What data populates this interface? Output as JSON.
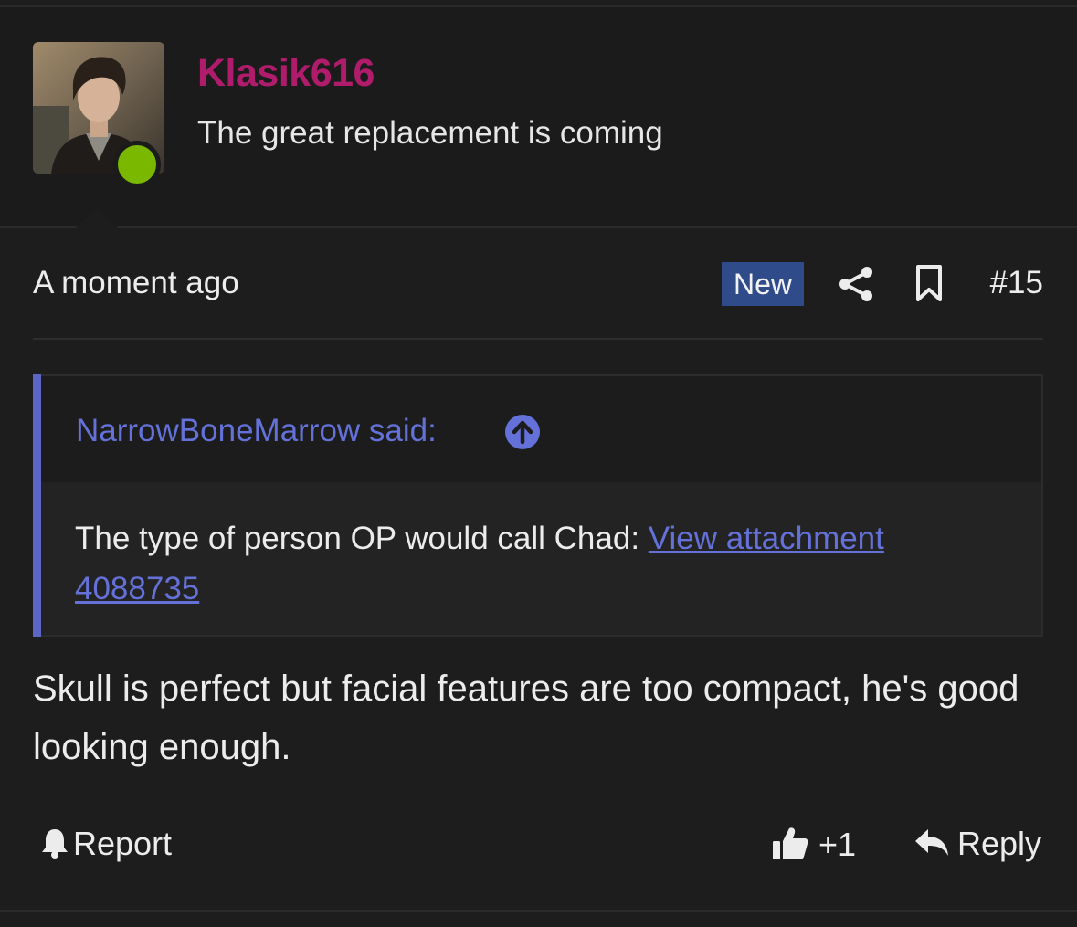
{
  "user": {
    "username": "Klasik616",
    "title": "The great replacement is coming",
    "online_color": "#7ab800",
    "username_color": "#b01c6c"
  },
  "meta": {
    "timestamp": "A moment ago",
    "badge": "New",
    "post_number": "#15",
    "share_icon": "share-icon",
    "bookmark_icon": "bookmark-icon"
  },
  "quote": {
    "author_line": "NarrowBoneMarrow said:",
    "text": "The type of person OP would call Chad: ",
    "link_text": "View attachment 4088735",
    "accent_color": "#5c66c6"
  },
  "message": {
    "text": "Skull is perfect but facial features are too compact, he's good looking enough."
  },
  "actions": {
    "report_label": "Report",
    "like_count": "+1",
    "reply_label": "Reply"
  }
}
